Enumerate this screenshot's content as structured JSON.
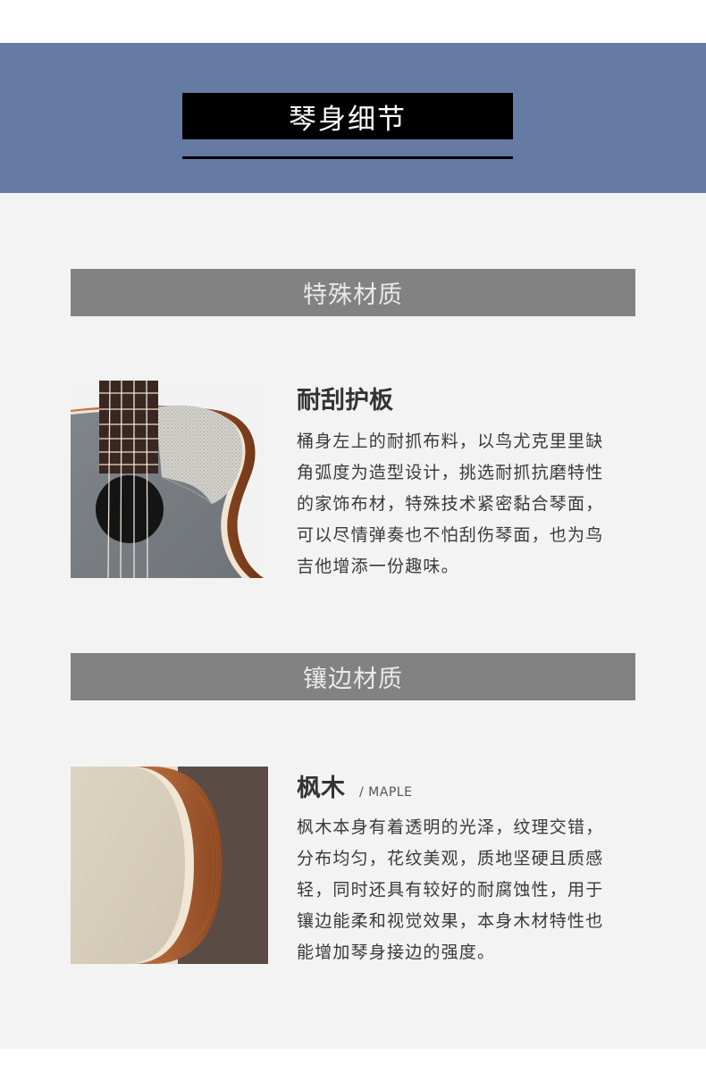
{
  "header": {
    "title": "琴身细节"
  },
  "sections": [
    {
      "heading": "特殊材质",
      "feature": {
        "title": "耐刮护板",
        "subtitle": "",
        "lines": [
          "桶身左上的耐抓布料，以鸟尤克里里缺",
          "角弧度为造型设计，挑选耐抓抗磨特性",
          "的家饰布材，特殊技术紧密黏合琴面，",
          "可以尽情弹奏也不怕刮伤琴面，也为鸟",
          "吉他增添一份趣味。"
        ]
      }
    },
    {
      "heading": "镶边材质",
      "feature": {
        "title": "枫木",
        "subtitle": "/  MAPLE",
        "lines": [
          "枫木本身有着透明的光泽，纹理交错，",
          "分布均匀，花纹美观，质地坚硬且质感",
          "轻，同时还具有较好的耐腐蚀性，用于",
          "镶边能柔和视觉效果，本身木材特性也",
          "能增加琴身接边的强度。"
        ]
      }
    }
  ],
  "colors": {
    "header_band": "#667ba3",
    "section_bar": "#828282",
    "content_bg": "#f3f3f3"
  }
}
